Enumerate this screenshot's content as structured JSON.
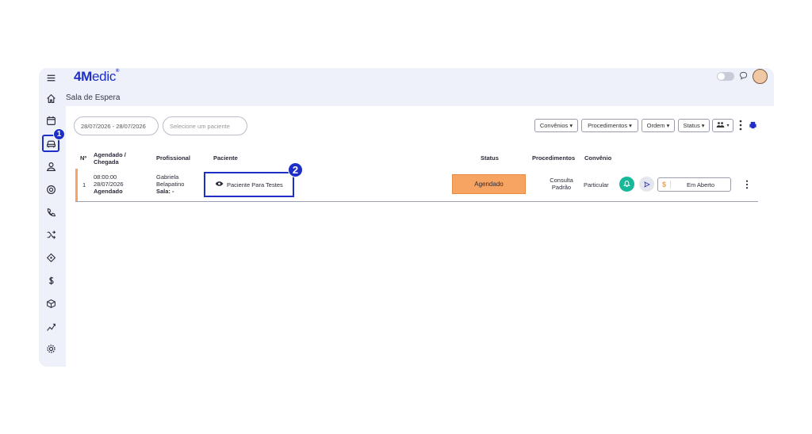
{
  "app": {
    "logo_bold": "4M",
    "logo_rest": "edic"
  },
  "breadcrumb": "Sala de Espera",
  "sidebar": {
    "items": [
      {
        "name": "menu-icon"
      },
      {
        "name": "home-icon"
      },
      {
        "name": "calendar-icon"
      },
      {
        "name": "waiting-room-icon"
      },
      {
        "name": "user-icon"
      },
      {
        "name": "at-icon"
      },
      {
        "name": "phone-icon"
      },
      {
        "name": "shuffle-icon"
      },
      {
        "name": "tag-icon"
      },
      {
        "name": "dollar-icon"
      },
      {
        "name": "box-icon"
      },
      {
        "name": "chart-icon"
      },
      {
        "name": "gear-icon"
      }
    ]
  },
  "filters": {
    "date_range": "28/07/2026 - 28/07/2026",
    "patient_placeholder": "Selecione um paciente",
    "convenios": "Convênios ▾",
    "procedimentos": "Procedimentos ▾",
    "ordem": "Ordem ▾",
    "status": "Status ▾"
  },
  "table": {
    "headers": {
      "num": "Nº",
      "scheduled": "Agendado /",
      "arrival": "Chegada",
      "professional": "Profissional",
      "patient": "Paciente",
      "status": "Status",
      "procedures": "Procedimentos",
      "insurance": "Convênio"
    },
    "rows": [
      {
        "num": "1",
        "time": "08:00:00",
        "date": "28/07/2026",
        "state": "Agendado",
        "prof_first": "Gabriela",
        "prof_last": "Belapatino",
        "room": "Sala: -",
        "patient": "Paciente Para Testes",
        "status": "Agendado",
        "proc_line1": "Consulta",
        "proc_line2": "Padrão",
        "insurance": "Particular",
        "payment": "Em Aberto"
      }
    ]
  },
  "badges": {
    "one": "1",
    "two": "2"
  },
  "colors": {
    "accent": "#1d2fc6",
    "status": "#f7a463",
    "bell": "#17b89a"
  }
}
